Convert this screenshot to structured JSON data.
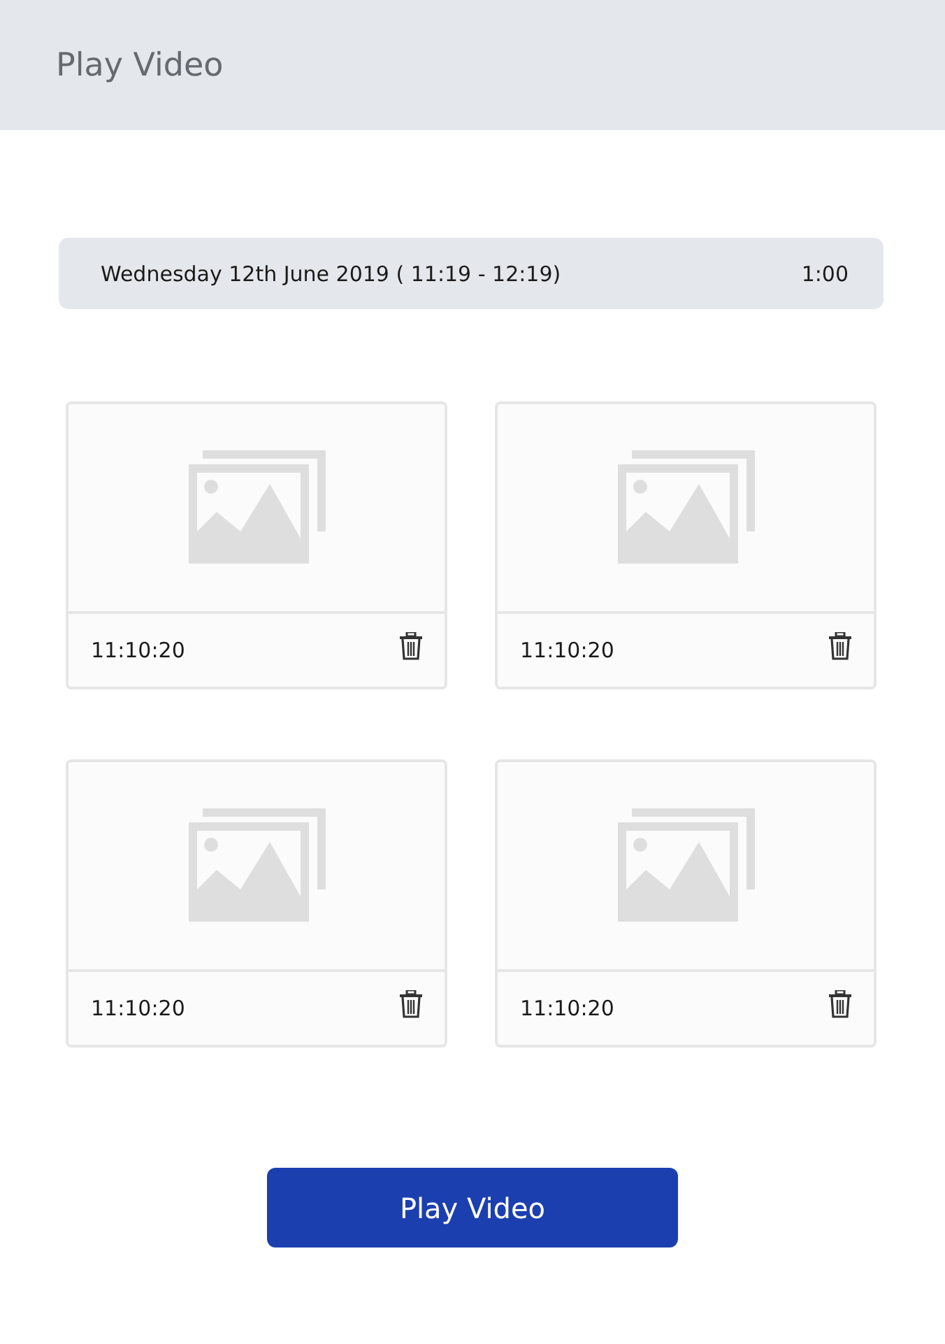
{
  "header": {
    "title": "Play Video"
  },
  "session": {
    "label": "Wednesday 12th June 2019 ( 11:19 - 12:19)",
    "duration": "1:00"
  },
  "clips": [
    {
      "time": "11:10:20"
    },
    {
      "time": "11:10:20"
    },
    {
      "time": "11:10:20"
    },
    {
      "time": "11:10:20"
    }
  ],
  "button": {
    "label": "Play Video"
  }
}
